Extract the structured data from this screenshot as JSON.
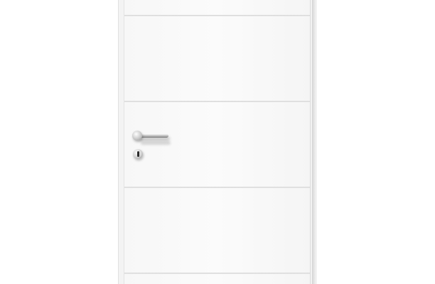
{
  "image": {
    "subject": "white-flush-door",
    "colors": {
      "background": "#ffffff",
      "door": "#f8f8f8",
      "groove": "#d3d3d3",
      "hardware": "#b9b9b9",
      "keyhole": "#2b2b2b"
    },
    "groove_count": 4,
    "hardware": {
      "handle_icon": "lever-handle-icon",
      "keyhole_icon": "keyhole-icon"
    }
  }
}
